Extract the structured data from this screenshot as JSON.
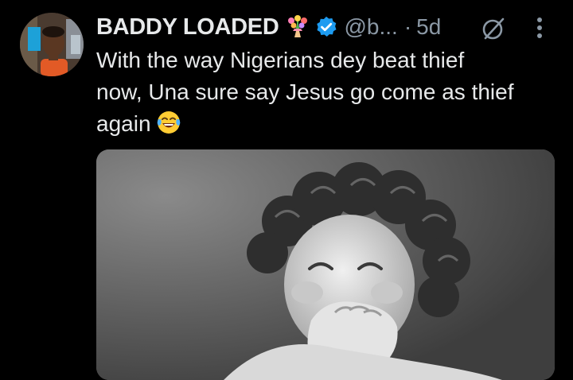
{
  "tweet": {
    "author": {
      "display_name": "BADDY LOADED",
      "name_emoji": "bouquet-emoji",
      "verified": true,
      "verified_color": "#1d9bf0",
      "handle": "@b...",
      "separator": "·",
      "time": "5d"
    },
    "text_lines": [
      "With the way Nigerians dey beat thief",
      "now, Una sure say Jesus go come as thief",
      "again"
    ],
    "text_emoji": "face-with-tears-of-joy-emoji",
    "media": {
      "type": "gif",
      "description_icon": "laughing-child-image"
    },
    "icons": [
      "grok-icon",
      "more-options-icon"
    ]
  },
  "colors": {
    "background": "#000000",
    "text_primary": "#e7e9ea",
    "text_secondary": "#8b98a5",
    "accent": "#1d9bf0"
  }
}
